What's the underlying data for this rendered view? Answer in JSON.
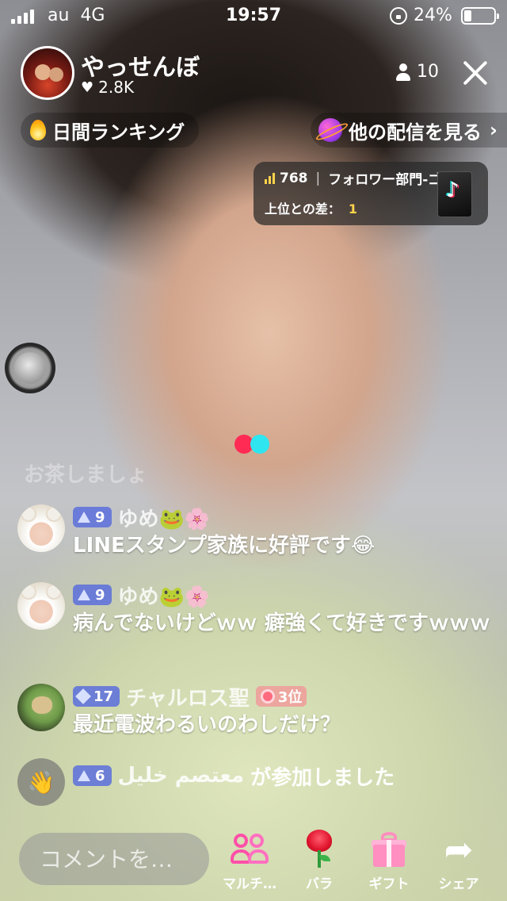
{
  "status_bar": {
    "carrier": "au",
    "network": "4G",
    "time": "19:57",
    "battery": "24%",
    "battery_level": 0.24
  },
  "host": {
    "name": "やっせんぼ",
    "likes": "2.8K",
    "viewers": "10"
  },
  "ranking": {
    "daily_label": "日間ランキング",
    "other_streams_label": "他の配信を見る",
    "rank_number": "768",
    "rank_category": "フォロワー部門-ゴー",
    "gap_label": "上位との差：",
    "gap_value": "1"
  },
  "faded_comment": "お茶しましょ",
  "comments": [
    {
      "level": "9",
      "name": "ゆめ🐸🌸",
      "text": "LINEスタンプ家族に好評です😂"
    },
    {
      "level": "9",
      "name": "ゆめ🐸🌸",
      "text": "病んでないけどｗｗ 癖強くて好きですｗｗｗ"
    },
    {
      "level": "17",
      "name": "チャルロス聖",
      "rank_badge": "3位",
      "text": "最近電波わるいのわしだけ？"
    }
  ],
  "join_event": {
    "level": "6",
    "name": "معتصم خليل",
    "text": "が参加しました"
  },
  "bottom_bar": {
    "comment_placeholder": "コメントを…",
    "multi_label": "マルチ…",
    "rose_label": "バラ",
    "gift_label": "ギフト",
    "share_label": "シェア"
  },
  "icons": {
    "heart": "heart-icon",
    "viewers": "person-icon",
    "close": "close-icon",
    "flame": "flame-icon",
    "planet": "planet-icon",
    "chevron": "chevron-right-icon",
    "rank_bars": "bars-icon",
    "tiktok": "tiktok-logo-icon",
    "wave": "wave-hand-icon",
    "level": "level-triangle-icon",
    "multi": "multi-guest-icon",
    "rose": "rose-icon",
    "gift": "gift-icon",
    "share": "share-arrow-icon"
  },
  "colors": {
    "accent_red": "#ff2b55",
    "accent_cyan": "#2ee5f0",
    "level_badge": "#5a6edc",
    "rank_highlight": "#ffd34a",
    "multi_pink": "#ff4fa8"
  }
}
